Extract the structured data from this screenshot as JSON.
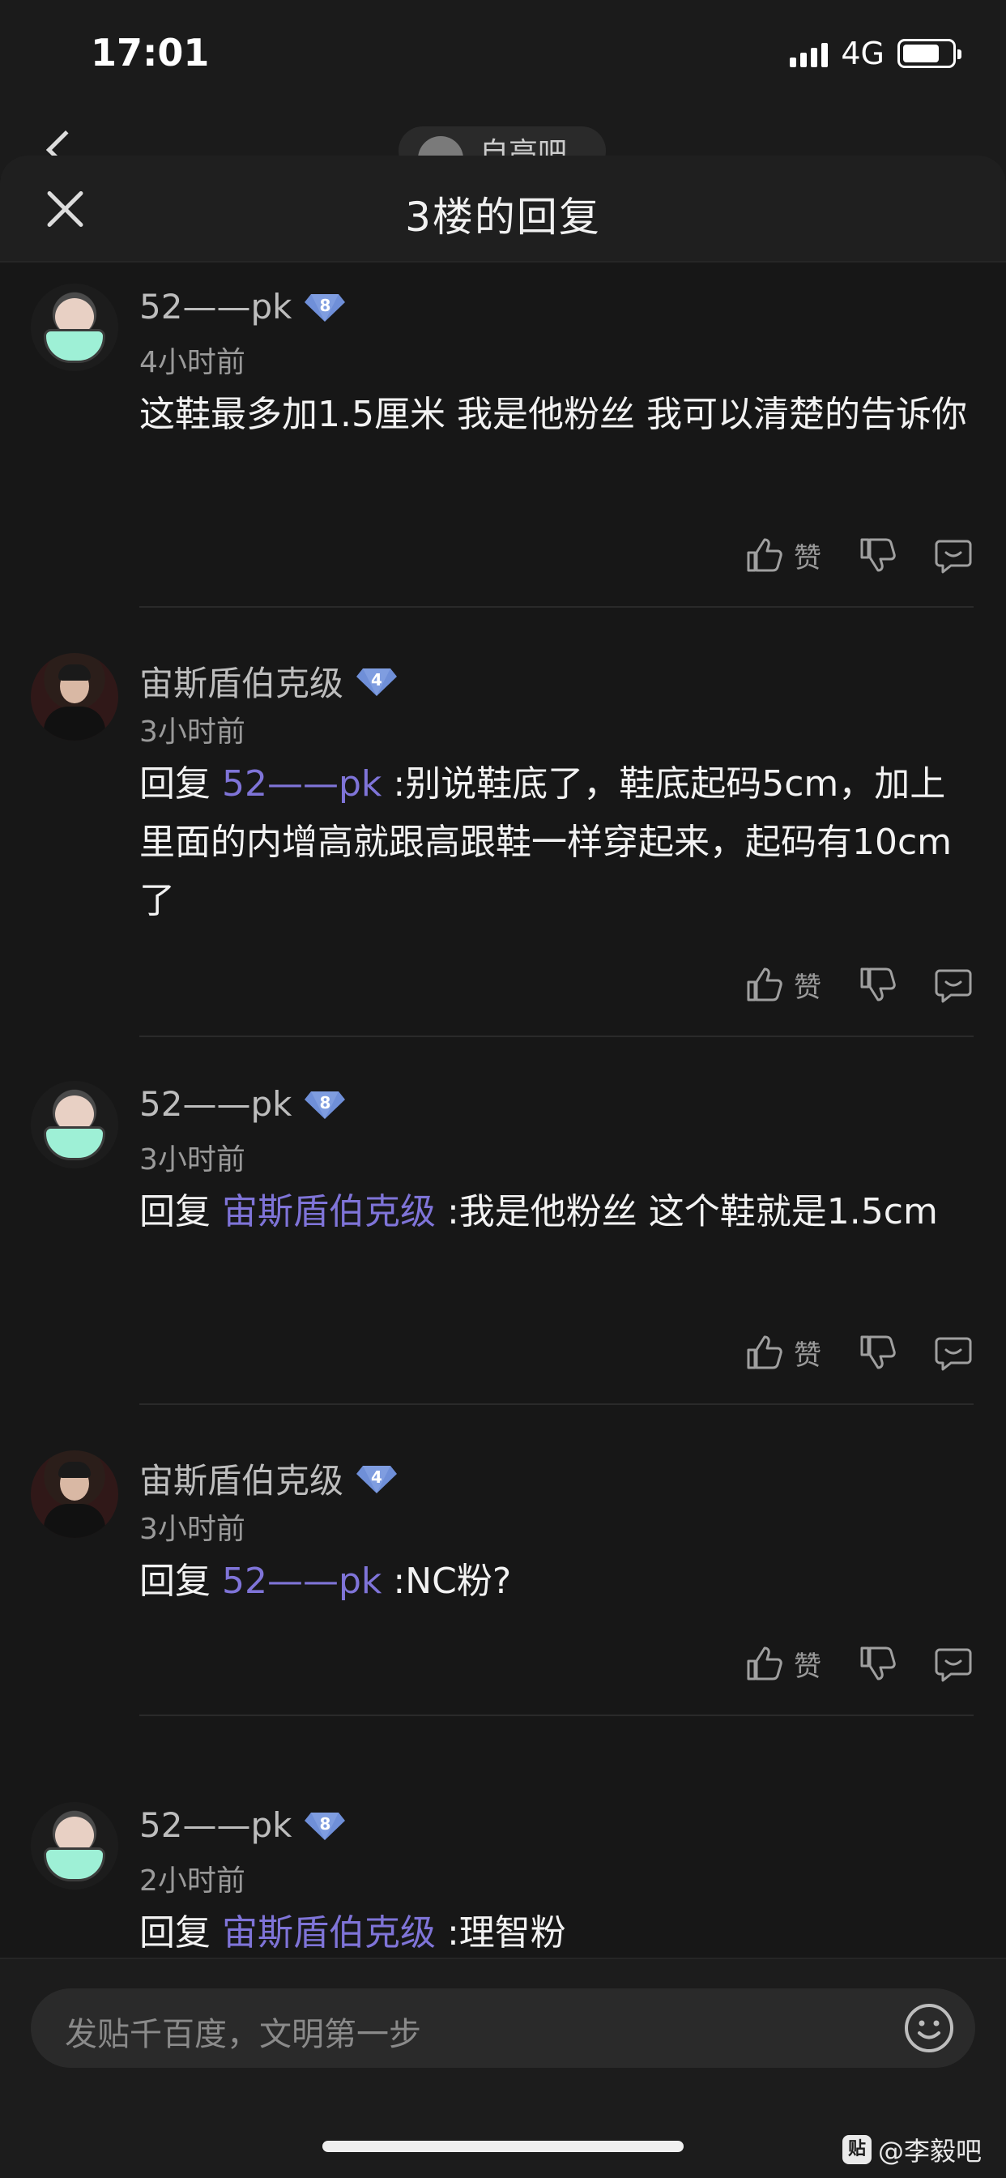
{
  "status_bar": {
    "time": "17:01",
    "network": "4G"
  },
  "background_header": {
    "forum_name": "自高吧"
  },
  "sheet": {
    "title": "3楼的回复",
    "comments": [
      {
        "user": "52——pk",
        "level": "8",
        "time": "4小时前",
        "reply_prefix": "",
        "mention": "",
        "text": "这鞋最多加1.5厘米 我是他粉丝 我可以清楚的告诉你",
        "like_label": "赞"
      },
      {
        "user": "宙斯盾伯克级",
        "level": "4",
        "time": "3小时前",
        "reply_prefix": "回复 ",
        "mention": "52——pk",
        "text": " :别说鞋底了，鞋底起码5cm，加上里面的内增高就跟高跟鞋一样穿起来，起码有10cm了",
        "like_label": "赞"
      },
      {
        "user": "52——pk",
        "level": "8",
        "time": "3小时前",
        "reply_prefix": "回复 ",
        "mention": "宙斯盾伯克级",
        "text": " :我是他粉丝 这个鞋就是1.5cm",
        "like_label": "赞"
      },
      {
        "user": "宙斯盾伯克级",
        "level": "4",
        "time": "3小时前",
        "reply_prefix": "回复 ",
        "mention": "52——pk",
        "text": " :NC粉?",
        "like_label": "赞"
      },
      {
        "user": "52——pk",
        "level": "8",
        "time": "2小时前",
        "reply_prefix": "回复 ",
        "mention": "宙斯盾伯克级",
        "text": " :理智粉",
        "like_label": ""
      }
    ]
  },
  "input": {
    "placeholder": "发贴千百度，文明第一步"
  },
  "watermark": {
    "logo": "贴",
    "text": "@李毅吧"
  },
  "colors": {
    "accent_mention": "#7f74d8",
    "level_badge": "#6f8fd8",
    "mask": "#9ef0d6"
  },
  "icons": [
    "close-icon",
    "thumbs-up-icon",
    "thumbs-down-icon",
    "reply-bubble-icon",
    "emoji-icon",
    "level-diamond-icon"
  ]
}
